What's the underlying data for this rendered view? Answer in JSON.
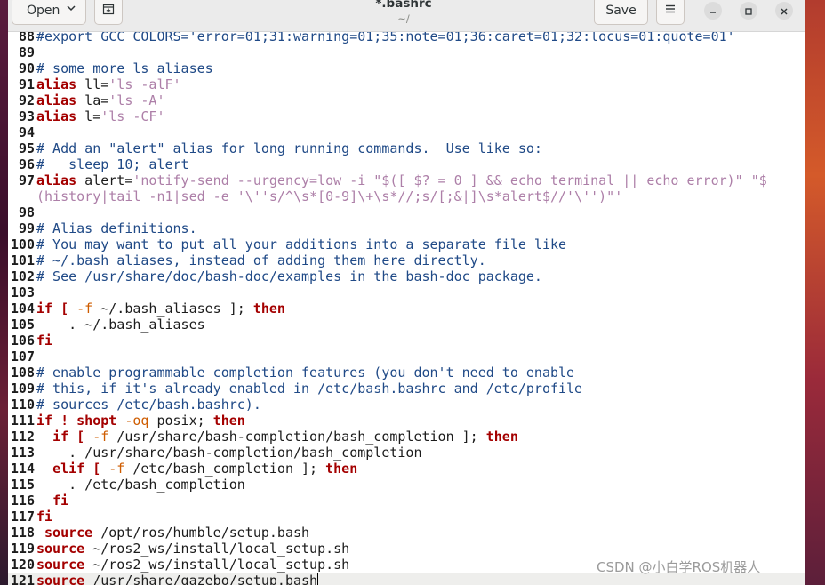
{
  "header": {
    "open_label": "Open",
    "title": "*.bashrc",
    "subtitle": "~/",
    "save_label": "Save"
  },
  "icons": {
    "open_chevron": "chevron-down-icon",
    "new_tab": "new-tab-icon",
    "menu": "hamburger-menu-icon",
    "minimize": "minimize-icon",
    "maximize": "maximize-icon",
    "close": "close-icon"
  },
  "colors": {
    "keyword": "#a40000",
    "comment": "#204a87",
    "string": "#ad7fa8"
  },
  "editor": {
    "lines": [
      {
        "n": "88",
        "t": "#export GCC_COLORS='error=01;31:warning=01;35:note=01;36:caret=01;32:locus=01:quote=01'"
      },
      {
        "n": "89",
        "t": ""
      },
      {
        "n": "90",
        "t": "# some more ls aliases"
      },
      {
        "n": "91",
        "t": "alias ll='ls -alF'"
      },
      {
        "n": "92",
        "t": "alias la='ls -A'"
      },
      {
        "n": "93",
        "t": "alias l='ls -CF'"
      },
      {
        "n": "94",
        "t": ""
      },
      {
        "n": "95",
        "t": "# Add an \"alert\" alias for long running commands.  Use like so:"
      },
      {
        "n": "96",
        "t": "#   sleep 10; alert"
      },
      {
        "n": "97",
        "t": "alias alert='notify-send --urgency=low -i \"$([ $? = 0 ] && echo terminal || echo error)\" \"$"
      },
      {
        "n": "",
        "t": "(history|tail -n1|sed -e '\\''s/^\\s*[0-9]\\+\\s*//;s/[;&|]\\s*alert$//'\\'')\"'"
      },
      {
        "n": "98",
        "t": ""
      },
      {
        "n": "99",
        "t": "# Alias definitions."
      },
      {
        "n": "100",
        "t": "# You may want to put all your additions into a separate file like"
      },
      {
        "n": "101",
        "t": "# ~/.bash_aliases, instead of adding them here directly."
      },
      {
        "n": "102",
        "t": "# See /usr/share/doc/bash-doc/examples in the bash-doc package."
      },
      {
        "n": "103",
        "t": ""
      },
      {
        "n": "104",
        "t": "if [ -f ~/.bash_aliases ]; then"
      },
      {
        "n": "105",
        "t": "    . ~/.bash_aliases"
      },
      {
        "n": "106",
        "t": "fi"
      },
      {
        "n": "107",
        "t": ""
      },
      {
        "n": "108",
        "t": "# enable programmable completion features (you don't need to enable"
      },
      {
        "n": "109",
        "t": "# this, if it's already enabled in /etc/bash.bashrc and /etc/profile"
      },
      {
        "n": "110",
        "t": "# sources /etc/bash.bashrc)."
      },
      {
        "n": "111",
        "t": "if ! shopt -oq posix; then"
      },
      {
        "n": "112",
        "t": "  if [ -f /usr/share/bash-completion/bash_completion ]; then"
      },
      {
        "n": "113",
        "t": "    . /usr/share/bash-completion/bash_completion"
      },
      {
        "n": "114",
        "t": "  elif [ -f /etc/bash_completion ]; then"
      },
      {
        "n": "115",
        "t": "    . /etc/bash_completion"
      },
      {
        "n": "116",
        "t": "  fi"
      },
      {
        "n": "117",
        "t": "fi"
      },
      {
        "n": "118",
        "t": " source /opt/ros/humble/setup.bash"
      },
      {
        "n": "119",
        "t": "source ~/ros2_ws/install/local_setup.sh"
      },
      {
        "n": "120",
        "t": "source ~/ros2_ws/install/local_setup.sh"
      },
      {
        "n": "121",
        "t": "source /usr/share/gazebo/setup.bash"
      }
    ]
  },
  "watermark": "CSDN @小白学ROS机器人"
}
